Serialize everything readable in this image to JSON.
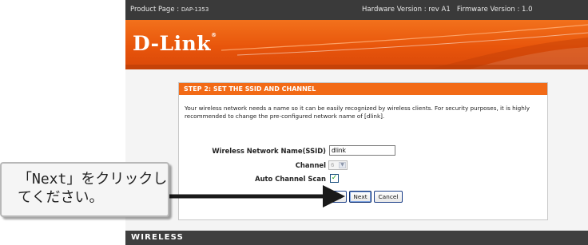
{
  "topbar": {
    "product_label": "Product Page :",
    "product_model": "DAP-1353",
    "hardware": "Hardware Version : rev A1",
    "firmware": "Firmware Version : 1.0"
  },
  "header": {
    "logo": "D-Link",
    "logo_mark": "®"
  },
  "wizard": {
    "title": "STEP 2: SET THE SSID AND CHANNEL",
    "description": "Your wireless network needs a name so it can be easily recognized by wireless clients. For security purposes, it is highly recommended to change the pre-configured network name of [dlink].",
    "ssid_label": "Wireless Network Name(SSID)",
    "ssid_value": "dlink",
    "channel_label": "Channel",
    "channel_value": "6",
    "auto_scan_label": "Auto Channel Scan",
    "auto_scan_checked": true,
    "prev_label": "Prev",
    "next_label": "Next",
    "cancel_label": "Cancel"
  },
  "footer": {
    "brand": "WIRELESS"
  },
  "callout": {
    "text": "「Next」をクリックしてください。"
  },
  "colors": {
    "accent": "#f26a16",
    "topbar": "#3a3a3a",
    "footer": "#3f3f3f",
    "content_bg": "#f4f4f4"
  },
  "icons": [
    "chevron-down-icon",
    "checkmark-icon",
    "pointer-arrow-icon"
  ]
}
